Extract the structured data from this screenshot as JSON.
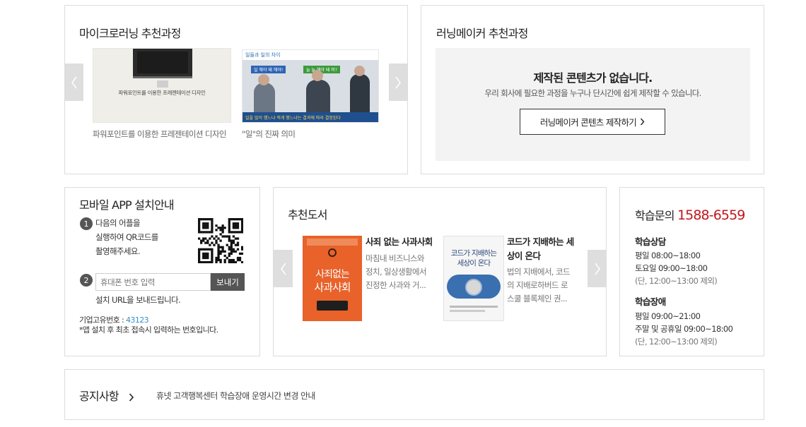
{
  "micro": {
    "title": "마이크로러닝 추천과정",
    "courses": [
      {
        "caption": "파워포인트를 이용한 프레젠테이션 디자인",
        "thumb_text": "파워포인트를 이용한 프레젠테이션 디자인"
      },
      {
        "caption": "\"일\"의 진짜 의미",
        "thumb_brand": "일들과 일의 차이",
        "thumb_bubble1": "일 해야 돼 해야!",
        "thumb_bubble2": "늘 늘 해야 돼 머?",
        "thumb_bottom": "일을 많이 했느냐 적게 했느냐는 결과에 따라 결정된다"
      }
    ]
  },
  "running_maker": {
    "title": "러닝메이커 추천과정",
    "empty_title": "제작된 콘텐츠가 없습니다.",
    "empty_desc": "우리 회사에 필요한 과정을 누구나 단시간에 쉽게 제작할 수 있습니다.",
    "button_label": "러닝메이커 콘텐츠 제작하기"
  },
  "mobile": {
    "title": "모바일 APP 설치안내",
    "step1_num": "1",
    "step1_lines": [
      "다음의 어플을",
      "실행하여 QR코드를",
      "촬영해주세요."
    ],
    "step2_num": "2",
    "input_placeholder": "휴대폰 번호 입력",
    "send_label": "보내기",
    "send_desc": "설치 URL을 보내드립니다.",
    "code_label": "기업고유번호 : ",
    "code_value": "43123",
    "code_note": "*앱 설치 후 최초 접속시 입력하는 번호입니다."
  },
  "books": {
    "title": "추천도서",
    "items": [
      {
        "title": "사죄 없는 사과사회",
        "desc": [
          "마침내 비즈니스와",
          "정치, 일상생활에서",
          "진정한 사과와 거..."
        ],
        "cover_title_1": "사죄없는",
        "cover_title_2": "사과사회"
      },
      {
        "title_lines": [
          "코드가 지배하는 세",
          "상이 온다"
        ],
        "desc": [
          "법의 지배에서, 코드",
          "의 지배로하버드 로",
          "스쿨 블록체인 권..."
        ],
        "cover_title_1": "코드가 지배하는",
        "cover_title_2": "세상이 온다"
      }
    ]
  },
  "contact": {
    "title": "학습문의",
    "phone": "1588-6559",
    "consult": {
      "head": "학습상담",
      "lines": [
        "평일 08:00~18:00",
        "토요일 09:00~18:00",
        "(단, 12:00~13:00 제외)"
      ]
    },
    "support": {
      "head": "학습장애",
      "lines": [
        "평일 09:00~21:00",
        "주말 및 공휴일 09:00~18:00",
        "(단, 12:00~13:00 제외)"
      ]
    }
  },
  "notice": {
    "title": "공지사항",
    "text": "휴넷 고객행복센터 학습장애 운영시간 변경 안내"
  },
  "colors": {
    "accent_red": "#c4161c",
    "link_blue": "#3a8fc9",
    "arrow_gray": "#dedede",
    "border": "#dcdcdc"
  }
}
